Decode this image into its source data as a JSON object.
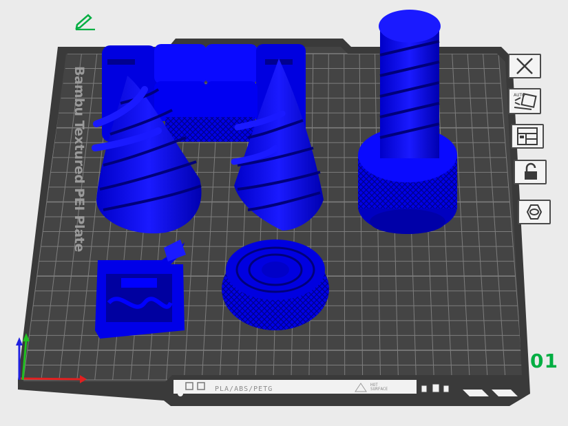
{
  "plate": {
    "label": "Bambu Textured PEI Plate",
    "number": "01",
    "filament_types": "PLA/ABS/PETG",
    "hot_surface_line1": "HOT",
    "hot_surface_line2": "SURFACE"
  },
  "toolbar": {
    "items": [
      {
        "name": "close-plate-button",
        "icon": "close-icon"
      },
      {
        "name": "auto-orient-button",
        "icon": "auto-orient-icon",
        "badge": "AUTO"
      },
      {
        "name": "arrange-button",
        "icon": "arrange-icon"
      },
      {
        "name": "lock-button",
        "icon": "unlock-icon"
      },
      {
        "name": "plate-settings-button",
        "icon": "hexagon-nut-icon"
      }
    ]
  },
  "colors": {
    "background": "#ebebeb",
    "plate": "#3e3e3e",
    "grid": "#7c7c7c",
    "model": "#0000ff",
    "accent": "#00ae42",
    "axis_x": "#e02020",
    "axis_y": "#20c020",
    "axis_z": "#2020e0"
  }
}
